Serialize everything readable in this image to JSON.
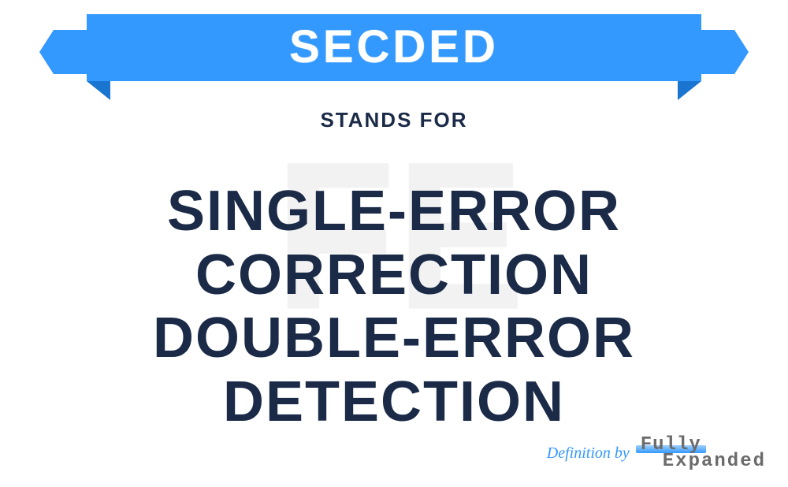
{
  "watermark": "FE",
  "banner": {
    "acronym": "SECDED"
  },
  "standsFor": "STANDS FOR",
  "definition": "SINGLE-ERROR\nCORRECTION\nDOUBLE-ERROR DETECTION",
  "footer": {
    "label": "Definition by",
    "logoLine1": "Fully",
    "logoLine2": "Expanded"
  }
}
